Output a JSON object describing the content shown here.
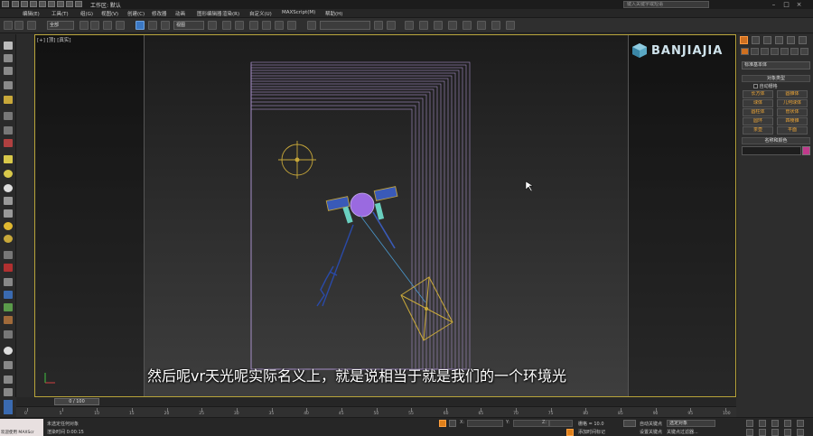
{
  "window": {
    "title": "工作区: 默认",
    "search_placeholder": "键入关键字或短语"
  },
  "menu": {
    "items": [
      "编辑(E)",
      "工具(T)",
      "组(G)",
      "视图(V)",
      "创建(C)",
      "修改器",
      "动画",
      "图形编辑器",
      "渲染(R)",
      "自定义(U)",
      "MAXScript(M)",
      "帮助(H)"
    ]
  },
  "toolbar": {
    "selection_filter": "全部",
    "ref_coord": "视图",
    "named_selection": ""
  },
  "viewport": {
    "label": "[+] [顶] [真实]",
    "subtitle": "然后呢vr天光呢实际名义上，就是说相当于就是我们的一个环境光",
    "watermark": "BANJIAJIA"
  },
  "command_panel": {
    "dropdown_value": "标准基本体",
    "object_type_header": "对象类型",
    "autogrid_label": "自动栅格",
    "buttons": [
      "长方体",
      "圆锥体",
      "球体",
      "几何球体",
      "圆柱体",
      "管状体",
      "圆环",
      "四棱锥",
      "茶壶",
      "平面"
    ],
    "name_color_header": "名称和颜色"
  },
  "timeline": {
    "frame_counter": "0 / 100",
    "ticks": [
      "0",
      "5",
      "10",
      "15",
      "20",
      "25",
      "30",
      "35",
      "40",
      "45",
      "50",
      "55",
      "60",
      "65",
      "70",
      "75",
      "80",
      "85",
      "90",
      "95",
      "100"
    ]
  },
  "statusbar": {
    "listener_label": "欢迎使用 MAXScr",
    "line1": "未选定任何对象",
    "line2": "渲染时间 0:00:15",
    "x_label": "X:",
    "y_label": "Y:",
    "z_label": "Z:",
    "grid_label": "栅格 = 10.0",
    "add_time_tag": "添加时间标记",
    "auto_key": "自动关键点",
    "set_key": "设置关键点",
    "selected_dropdown": "选定对象",
    "key_filters": "关键点过滤器..."
  },
  "colors": {
    "viewport_border": "#b8a43a",
    "active_accent": "#d07020",
    "object_color": "#c03a8c",
    "light_wire": "#c8a83a"
  }
}
